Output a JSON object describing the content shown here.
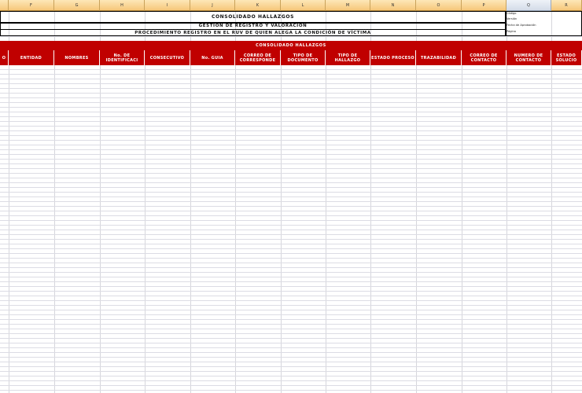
{
  "columns": [
    "",
    "F",
    "G",
    "H",
    "I",
    "J",
    "K",
    "L",
    "M",
    "N",
    "O",
    "P",
    "Q",
    "R"
  ],
  "titles": {
    "main": "CONSOLIDADO HALLAZGOS",
    "sub": "GESTIÓN DE REGISTRO Y VALORACIÓN",
    "procedure": "PROCEDIMIENTO REGISTRO  EN EL RUV DE QUIEN ALEGA LA CONDICIÓN DE VÍCTIMA"
  },
  "side_labels": {
    "code": "Código",
    "version": "Versión",
    "approval_date": "Fecha de Aprobación",
    "page": "Página"
  },
  "banner": "CONSOLIDADO HALLAZGOS",
  "headers": [
    "O",
    "ENTIDAD",
    "NOMBRES",
    "No. DE IDENTIFICACI",
    "CONSECUTIVO",
    "No. GUIA",
    "CORREO DE CORRESPONDE",
    "TIPO DE DOCUMENTO",
    "TIPO DE HALLAZGO",
    "ESTADO PROCESO",
    "TRAZABILIDAD",
    "CORREO DE CONTACTO",
    "NUMERO DE CONTACTO",
    "ESTADO SOLUCIO"
  ]
}
